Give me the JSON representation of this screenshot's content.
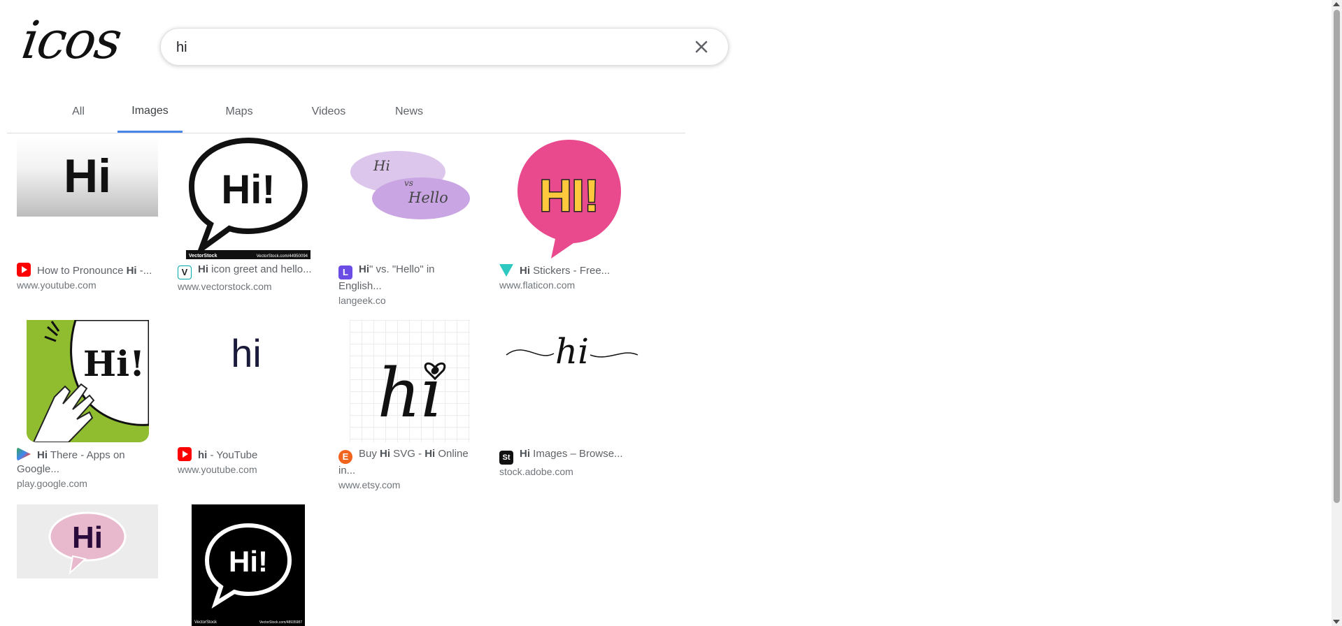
{
  "brand": {
    "logo_text": "icos"
  },
  "search": {
    "query": "hi"
  },
  "tabs": [
    {
      "label": "All"
    },
    {
      "label": "Images",
      "active": true
    },
    {
      "label": "Maps"
    },
    {
      "label": "Videos"
    },
    {
      "label": "News"
    }
  ],
  "results": [
    {
      "title_bold": "",
      "title_pre": "How to Pronounce ",
      "title_mid": "Hi",
      "title_post": " -...",
      "line2": "",
      "site": "www.youtube.com",
      "icon": "youtube-icon"
    },
    {
      "title_pre": "",
      "title_mid": "Hi",
      "title_post": " icon greet and hello...",
      "line2": "",
      "site": "www.vectorstock.com",
      "icon": "vectorstock-icon"
    },
    {
      "title_pre": "",
      "title_mid": "Hi",
      "title_post": "\" vs. \"Hello\" in",
      "line2": "English...",
      "site": "langeek.co",
      "icon": "langeek-icon"
    },
    {
      "title_pre": "",
      "title_mid": "Hi",
      "title_post": " Stickers - Free...",
      "line2": "",
      "site": "www.flaticon.com",
      "icon": "flaticon-icon"
    },
    {
      "title_pre": "",
      "title_mid": "Hi",
      "title_post": " There - Apps on",
      "line2": "Google...",
      "site": "play.google.com",
      "icon": "google-play-icon"
    },
    {
      "title_pre": "",
      "title_mid": "hi",
      "title_post": " - YouTube",
      "line2": "",
      "site": "www.youtube.com",
      "icon": "youtube-icon"
    },
    {
      "title_pre": "Buy ",
      "title_mid": "Hi",
      "title_post": " SVG - ",
      "title_mid2": "Hi",
      "title_post2": " Online",
      "line2": "in...",
      "site": "www.etsy.com",
      "icon": "etsy-icon"
    },
    {
      "title_pre": "",
      "title_mid": "Hi",
      "title_post": " Images – Browse...",
      "line2": "",
      "site": "stock.adobe.com",
      "icon": "adobe-stock-icon"
    }
  ],
  "images": {
    "hi_text": "Hi",
    "hi_excl": "Hi!",
    "hi_caps": "HI!",
    "hi_lower": "hi",
    "vs": "vs",
    "hello": "Hello",
    "watermark_left": "VectorStock",
    "watermark_right": "VectorStock.com/44950094",
    "watermark_right2": "VectorStock.com/48935987"
  },
  "colors": {
    "accent": "#4a86e8",
    "youtube": "#ff0000",
    "flaticon_pink": "#e84a8d",
    "flaticon_yellow": "#ffc83d"
  }
}
